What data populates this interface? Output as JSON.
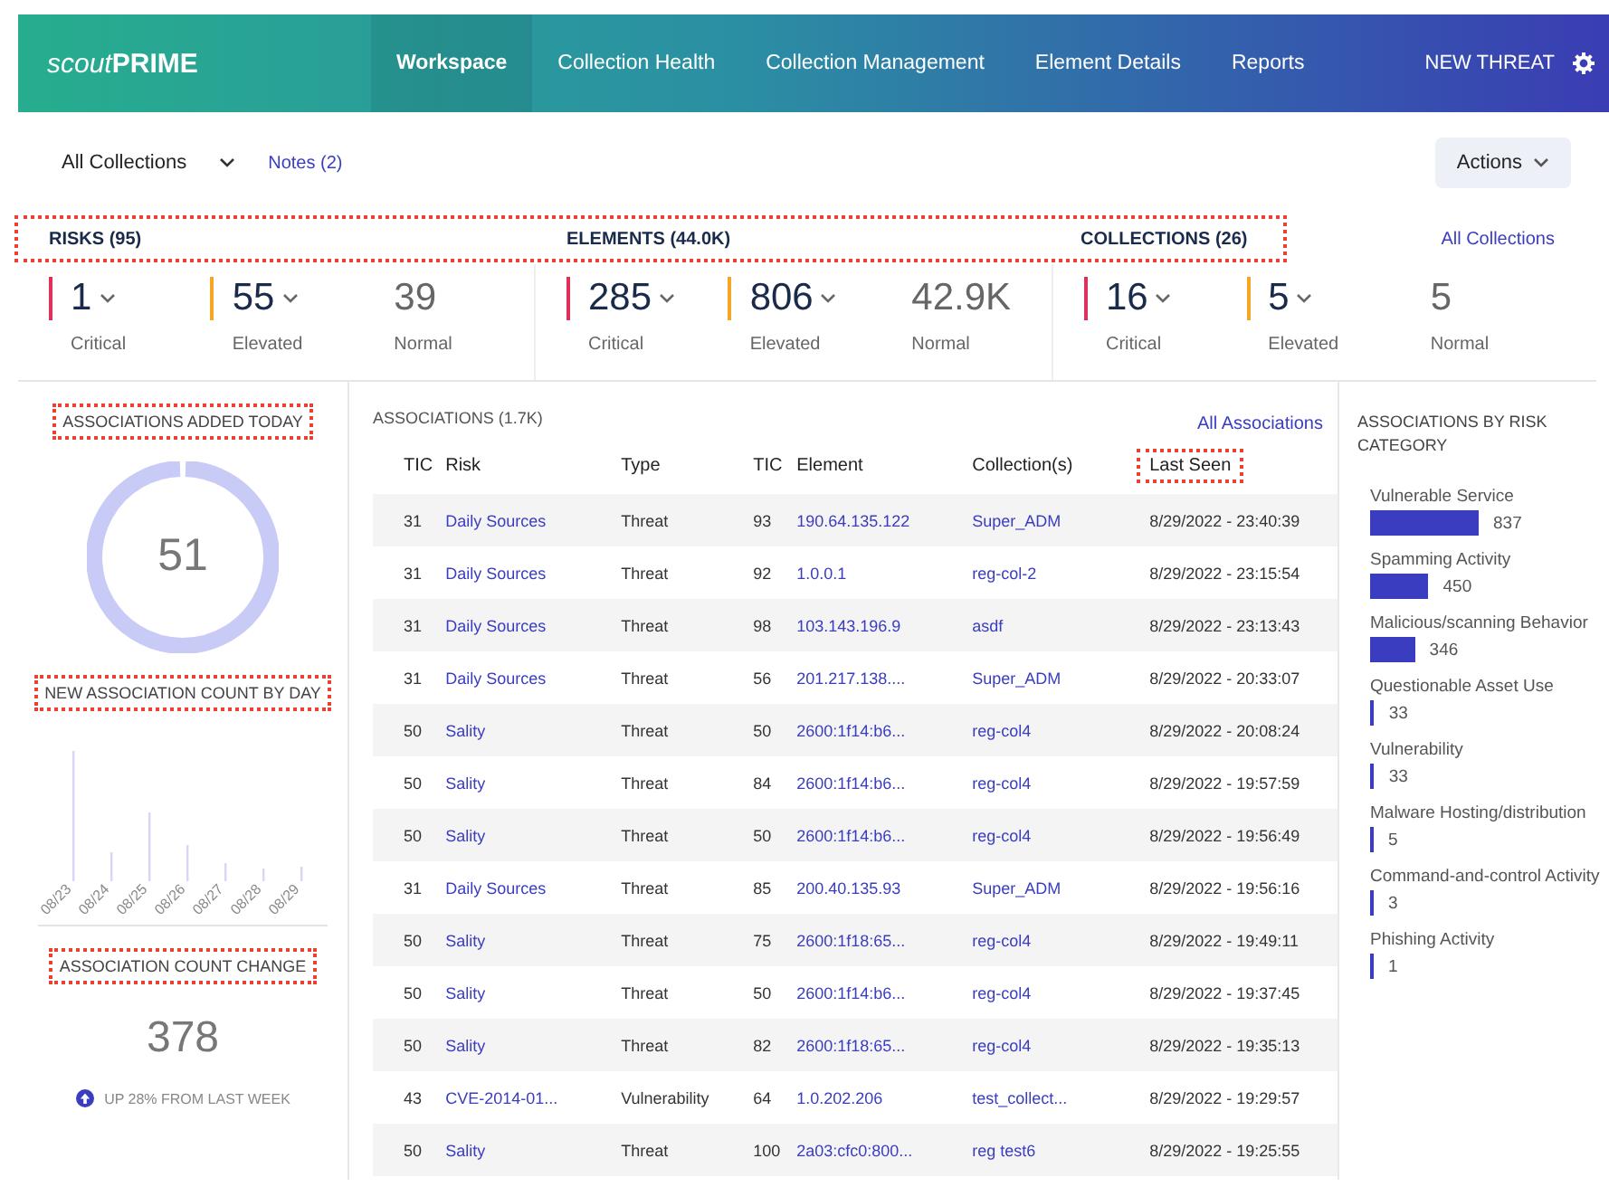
{
  "header": {
    "logo": {
      "prefix": "scout",
      "suffix": "PRIME"
    },
    "nav": [
      {
        "label": "Workspace",
        "selected": true
      },
      {
        "label": "Collection Health",
        "selected": false
      },
      {
        "label": "Collection Management",
        "selected": false
      },
      {
        "label": "Element Details",
        "selected": false
      },
      {
        "label": "Reports",
        "selected": false
      }
    ],
    "action": "NEW THREAT"
  },
  "toolbar": {
    "collection_select": "All Collections",
    "notes_link": "Notes (2)",
    "actions_button": "Actions"
  },
  "summary": {
    "highlighted": true,
    "link": "All Collections",
    "groups": [
      {
        "title": "RISKS (95)",
        "stats": [
          {
            "value": "1",
            "label": "Critical",
            "color": "#e0305a",
            "has_menu": true
          },
          {
            "value": "55",
            "label": "Elevated",
            "color": "#f5a623",
            "has_menu": true
          },
          {
            "value": "39",
            "label": "Normal",
            "has_menu": false
          }
        ]
      },
      {
        "title": "ELEMENTS (44.0K)",
        "stats": [
          {
            "value": "285",
            "label": "Critical",
            "color": "#e0305a",
            "has_menu": true
          },
          {
            "value": "806",
            "label": "Elevated",
            "color": "#f5a623",
            "has_menu": true
          },
          {
            "value": "42.9K",
            "label": "Normal",
            "has_menu": false
          }
        ]
      },
      {
        "title": "COLLECTIONS (26)",
        "stats": [
          {
            "value": "16",
            "label": "Critical",
            "color": "#e0305a",
            "has_menu": true
          },
          {
            "value": "5",
            "label": "Elevated",
            "color": "#f5a623",
            "has_menu": true
          },
          {
            "value": "5",
            "label": "Normal",
            "has_menu": false
          }
        ]
      }
    ]
  },
  "left_panel": {
    "added_today": {
      "title": "ASSOCIATIONS ADDED TODAY",
      "highlighted": true,
      "value": "51"
    },
    "by_day": {
      "title": "NEW ASSOCIATION COUNT BY DAY",
      "highlighted": true,
      "dates": [
        "08/23",
        "08/24",
        "08/25",
        "08/26",
        "08/27",
        "08/28",
        "08/29"
      ]
    },
    "change": {
      "title": "ASSOCIATION COUNT CHANGE",
      "highlighted": true,
      "value": "378",
      "up": true,
      "trend": "UP 28% FROM LAST WEEK"
    }
  },
  "associations": {
    "title": "ASSOCIATIONS (1.7K)",
    "link": "All Associations",
    "columns": [
      {
        "label": "TIC",
        "kind": "text",
        "highlighted": false
      },
      {
        "label": "Risk",
        "kind": "link",
        "highlighted": false
      },
      {
        "label": "Type",
        "kind": "text",
        "highlighted": false
      },
      {
        "label": "TIC",
        "kind": "text",
        "highlighted": false
      },
      {
        "label": "Element",
        "kind": "link",
        "highlighted": false
      },
      {
        "label": "Collection(s)",
        "kind": "link",
        "highlighted": false
      },
      {
        "label": "Last Seen",
        "kind": "text",
        "highlighted": true
      }
    ],
    "rows": [
      [
        "31",
        "Daily Sources",
        "Threat",
        "93",
        "190.64.135.122",
        "Super_ADM",
        "8/29/2022 - 23:40:39"
      ],
      [
        "31",
        "Daily Sources",
        "Threat",
        "92",
        "1.0.0.1",
        "reg-col-2",
        "8/29/2022 - 23:15:54"
      ],
      [
        "31",
        "Daily Sources",
        "Threat",
        "98",
        "103.143.196.9",
        "asdf",
        "8/29/2022 - 23:13:43"
      ],
      [
        "31",
        "Daily Sources",
        "Threat",
        "56",
        "201.217.138....",
        "Super_ADM",
        "8/29/2022 - 20:33:07"
      ],
      [
        "50",
        "Sality",
        "Threat",
        "50",
        "2600:1f14:b6...",
        "reg-col4",
        "8/29/2022 - 20:08:24"
      ],
      [
        "50",
        "Sality",
        "Threat",
        "84",
        "2600:1f14:b6...",
        "reg-col4",
        "8/29/2022 - 19:57:59"
      ],
      [
        "50",
        "Sality",
        "Threat",
        "50",
        "2600:1f14:b6...",
        "reg-col4",
        "8/29/2022 - 19:56:49"
      ],
      [
        "31",
        "Daily Sources",
        "Threat",
        "85",
        "200.40.135.93",
        "Super_ADM",
        "8/29/2022 - 19:56:16"
      ],
      [
        "50",
        "Sality",
        "Threat",
        "75",
        "2600:1f18:65...",
        "reg-col4",
        "8/29/2022 - 19:49:11"
      ],
      [
        "50",
        "Sality",
        "Threat",
        "50",
        "2600:1f14:b6...",
        "reg-col4",
        "8/29/2022 - 19:37:45"
      ],
      [
        "50",
        "Sality",
        "Threat",
        "82",
        "2600:1f18:65...",
        "reg-col4",
        "8/29/2022 - 19:35:13"
      ],
      [
        "43",
        "CVE-2014-01...",
        "Vulnerability",
        "64",
        "1.0.202.206",
        "test_collect...",
        "8/29/2022 - 19:29:57"
      ],
      [
        "50",
        "Sality",
        "Threat",
        "100",
        "2a03:cfc0:800...",
        "reg test6",
        "8/29/2022 - 19:25:55"
      ]
    ]
  },
  "risk_categories": {
    "title": "ASSOCIATIONS BY RISK CATEGORY",
    "items": [
      {
        "label": "Vulnerable Service",
        "count": "837"
      },
      {
        "label": "Spamming Activity",
        "count": "450"
      },
      {
        "label": "Malicious/scanning Behavior",
        "count": "346"
      },
      {
        "label": "Questionable Asset Use",
        "count": "33"
      },
      {
        "label": "Vulnerability",
        "count": "33"
      },
      {
        "label": "Malware Hosting/distribution",
        "count": "5"
      },
      {
        "label": "Command-and-control Activity",
        "count": "3"
      },
      {
        "label": "Phishing Activity",
        "count": "1"
      }
    ]
  }
}
